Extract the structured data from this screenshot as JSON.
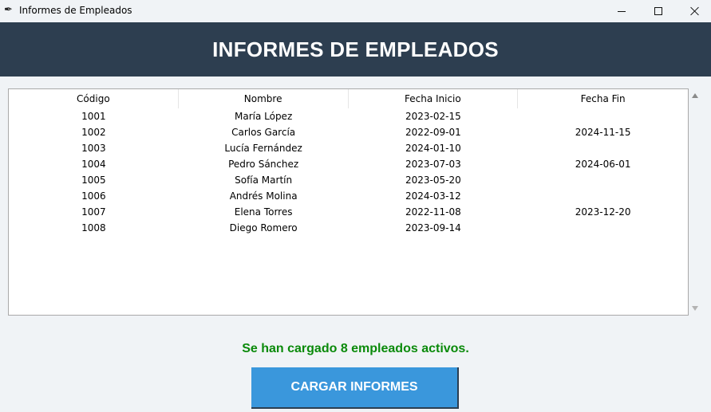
{
  "window": {
    "title": "Informes de Empleados",
    "icon": "feather-icon",
    "controls": [
      "minimize",
      "maximize",
      "close"
    ]
  },
  "header": {
    "title": "INFORMES DE EMPLEADOS",
    "background": "#2d3e50"
  },
  "table": {
    "columns": [
      "Código",
      "Nombre",
      "Fecha Inicio",
      "Fecha Fin"
    ],
    "rows": [
      [
        "1001",
        "María López",
        "2023-02-15",
        ""
      ],
      [
        "1002",
        "Carlos García",
        "2022-09-01",
        "2024-11-15"
      ],
      [
        "1003",
        "Lucía Fernández",
        "2024-01-10",
        ""
      ],
      [
        "1004",
        "Pedro Sánchez",
        "2023-07-03",
        "2024-06-01"
      ],
      [
        "1005",
        "Sofía Martín",
        "2023-05-20",
        ""
      ],
      [
        "1006",
        "Andrés Molina",
        "2024-03-12",
        ""
      ],
      [
        "1007",
        "Elena Torres",
        "2022-11-08",
        "2023-12-20"
      ],
      [
        "1008",
        "Diego Romero",
        "2023-09-14",
        ""
      ]
    ]
  },
  "status": {
    "text": "Se han cargado 8 empleados activos.",
    "color": "#0a8a0a"
  },
  "actions": {
    "load_label": "CARGAR INFORMES",
    "button_color": "#3a97dc"
  }
}
